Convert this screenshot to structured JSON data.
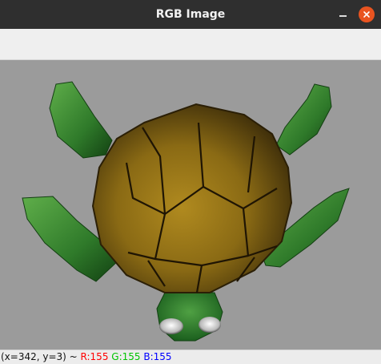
{
  "window": {
    "title": "RGB Image"
  },
  "titlebar_buttons": {
    "minimize_icon": "minimize-icon",
    "close_icon": "close-icon",
    "close_color": "#e95420"
  },
  "canvas": {
    "background_color": "#9b9b9b",
    "image_subject": "turtle-render"
  },
  "status": {
    "coords": "(x=342, y=3) ~ ",
    "r": "R:155",
    "g": "G:155",
    "b": "B:155",
    "r_color": "#ff0000",
    "g_color": "#00c400",
    "b_color": "#0000ff"
  }
}
